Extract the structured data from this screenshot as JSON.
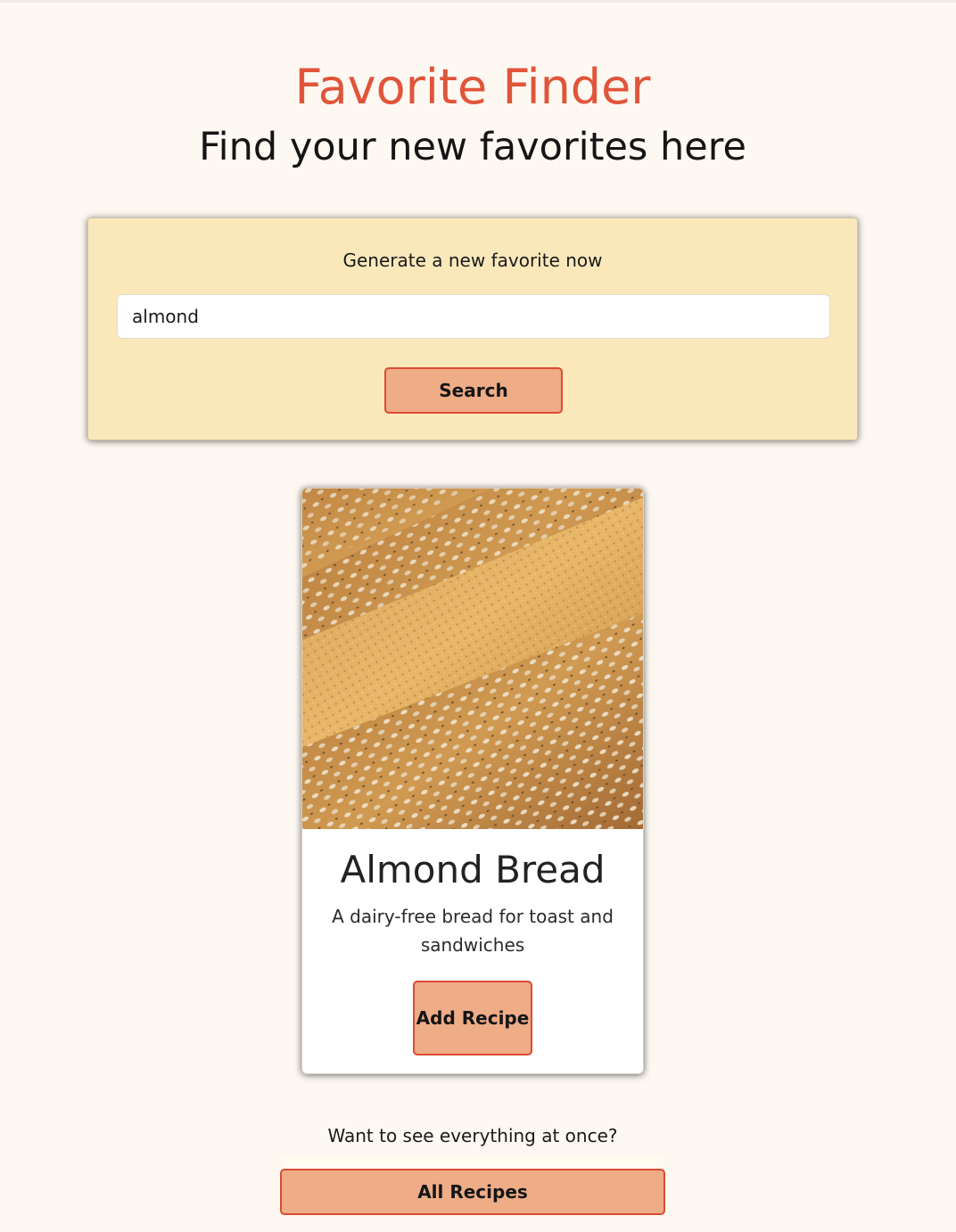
{
  "header": {
    "title": "Favorite Finder",
    "subtitle": "Find your new favorites here"
  },
  "search_panel": {
    "label": "Generate a new favorite now",
    "input_value": "almond",
    "button_label": "Search"
  },
  "recipe_card": {
    "image_alt": "almond bread loaf with sesame seeds",
    "title": "Almond Bread",
    "description": "A dairy-free bread for toast and sandwiches",
    "button_label": "Add Recipe"
  },
  "footer": {
    "prompt": "Want to see everything at once?",
    "button_label": "All Recipes"
  },
  "colors": {
    "accent": "#e0553a",
    "button_fill": "#eeac87",
    "panel_bg": "#fae8ba",
    "page_bg": "#fdf8f1"
  }
}
